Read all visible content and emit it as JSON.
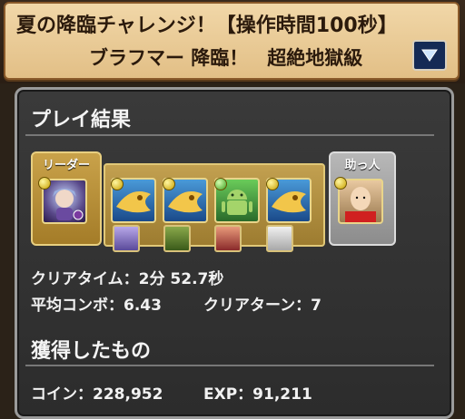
{
  "header": {
    "title": "夏の降臨チャレンジ！【操作時間100秒】",
    "subtitle": "ブラフマー 降臨！　超絶地獄級",
    "menu_icon": "triangle-down-icon"
  },
  "result": {
    "section_title": "プレイ結果",
    "leader_label": "リーダー",
    "helper_label": "助っ人",
    "clear_time": "クリアタイム：2分 52.7秒",
    "avg_combo": "平均コンボ：6.43",
    "clear_turns": "クリアターン：7"
  },
  "rewards": {
    "section_title": "獲得したもの",
    "coins": "コイン：228,952",
    "exp": "EXP：91,211"
  },
  "colors": {
    "accent_gold": "#c9a24a",
    "helper_gray": "#a0a0a0",
    "banner": "#f1d7a8",
    "panel": "#333333"
  }
}
